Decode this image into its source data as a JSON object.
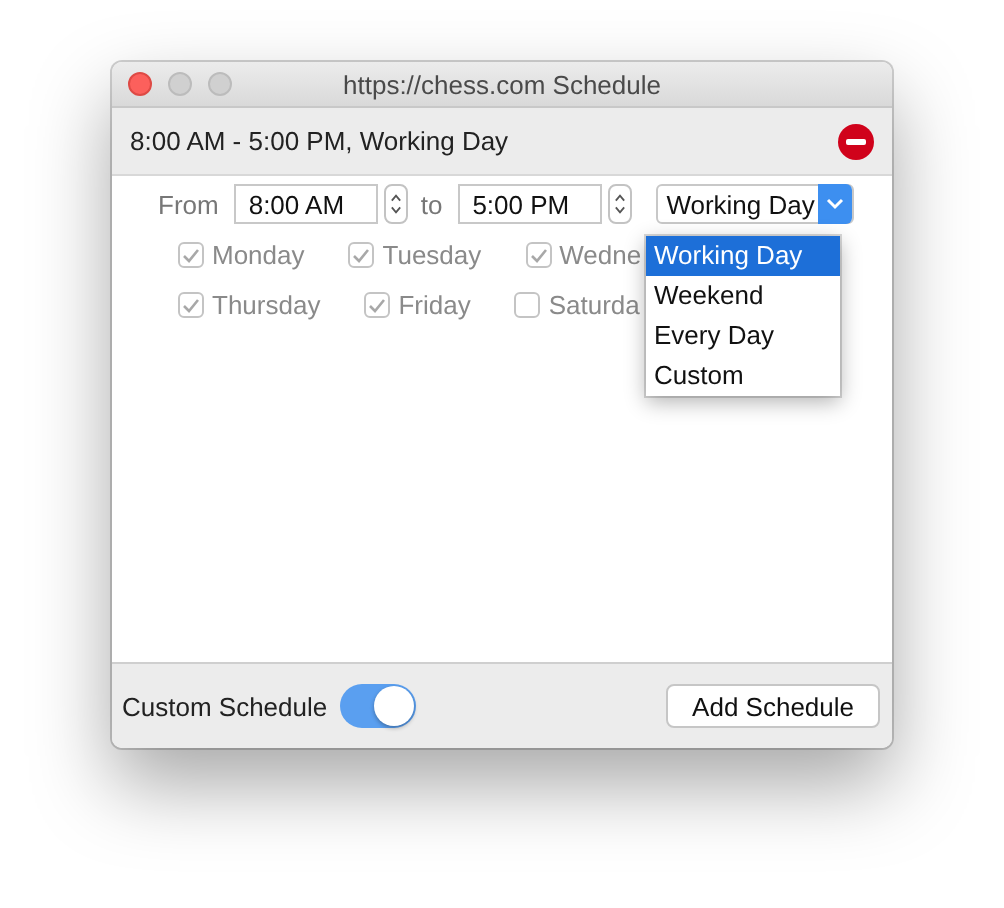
{
  "window": {
    "title": "https://chess.com Schedule"
  },
  "schedule_header": {
    "text": "8:00 AM - 5:00 PM, Working Day"
  },
  "time_range": {
    "from_label": "From",
    "from": "8:00 AM",
    "to_label": "to",
    "to": "5:00 PM"
  },
  "preset_select": {
    "value": "Working Day",
    "expanded": true,
    "options": [
      {
        "label": "Working Day",
        "selected": true
      },
      {
        "label": "Weekend",
        "selected": false
      },
      {
        "label": "Every Day",
        "selected": false
      },
      {
        "label": "Custom",
        "selected": false
      }
    ]
  },
  "day_rows": [
    [
      {
        "label": "Monday",
        "checked": true,
        "disabled": true
      },
      {
        "label": "Tuesday",
        "checked": true,
        "disabled": true
      },
      {
        "label": "Wedne",
        "checked": true,
        "disabled": true
      }
    ],
    [
      {
        "label": "Thursday",
        "checked": true,
        "disabled": true
      },
      {
        "label": "Friday",
        "checked": true,
        "disabled": true
      },
      {
        "label": "Saturda",
        "checked": false,
        "disabled": true
      }
    ]
  ],
  "footer": {
    "toggle_label": "Custom Schedule",
    "toggle_on": true,
    "button": "Add Schedule"
  }
}
